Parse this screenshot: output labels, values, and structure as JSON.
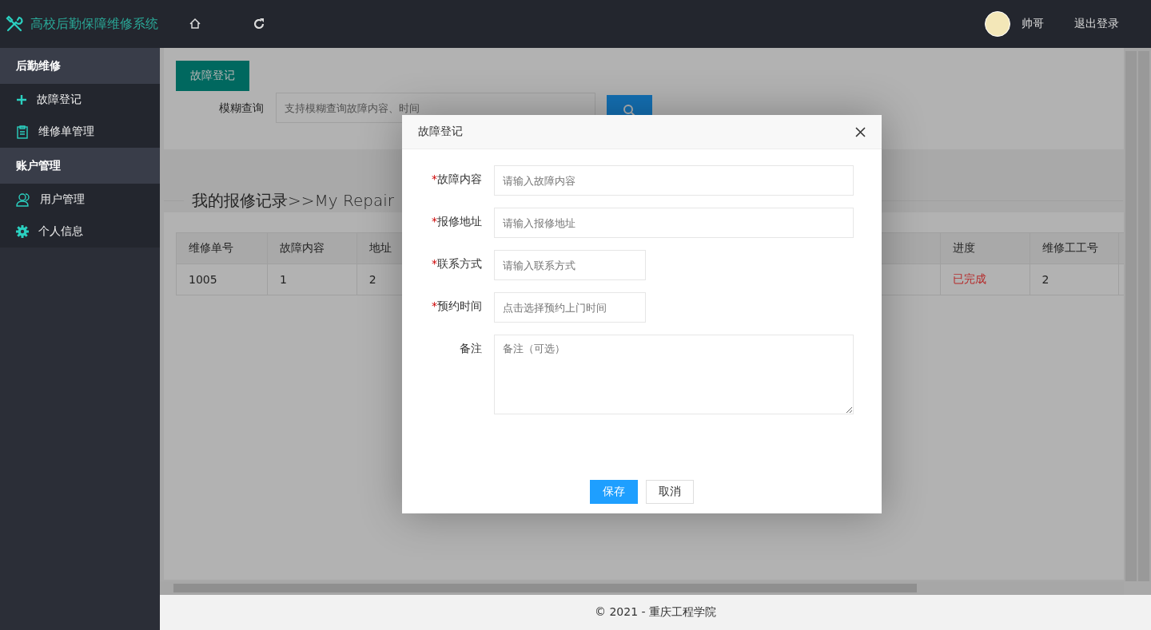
{
  "header": {
    "title": "高校后勤保障维修系统",
    "user": {
      "name": "帅哥"
    },
    "logout": "退出登录"
  },
  "sidebar": {
    "groups": [
      {
        "title": "后勤维修",
        "items": [
          {
            "label": "故障登记"
          },
          {
            "label": "维修单管理"
          }
        ]
      },
      {
        "title": "账户管理",
        "items": [
          {
            "label": "用户管理"
          },
          {
            "label": "个人信息"
          }
        ]
      }
    ]
  },
  "toolbar": {
    "add_button": "故障登记",
    "search_label": "模糊查询",
    "search": {
      "placeholder": "支持模糊查询故障内容、时间"
    }
  },
  "section_title": "我的报修记录>>My Repair",
  "table": {
    "columns": [
      "维修单号",
      "故障内容",
      "地址",
      "进度",
      "维修工工号"
    ],
    "rows": [
      {
        "cells": [
          "1005",
          "1",
          "2",
          {
            "text": "已完成",
            "color": "#b52a2a"
          },
          "2"
        ]
      }
    ]
  },
  "dialog": {
    "title": "故障登记",
    "required_mark": "*",
    "fields": [
      {
        "label": "故障内容",
        "required": true,
        "kind": "wide",
        "placeholder": "请输入故障内容"
      },
      {
        "label": "报修地址",
        "required": true,
        "kind": "wide",
        "placeholder": "请输入报修地址"
      },
      {
        "label": "联系方式",
        "required": true,
        "kind": "narrow",
        "placeholder": "请输入联系方式"
      },
      {
        "label": "预约时间",
        "required": true,
        "kind": "narrow",
        "placeholder": "点击选择预约上门时间"
      },
      {
        "label": "备注",
        "required": false,
        "kind": "textarea",
        "placeholder": "备注（可选）"
      }
    ],
    "buttons": [
      {
        "label": "保存",
        "kind": "primary"
      },
      {
        "label": "取消",
        "kind": "default"
      }
    ]
  },
  "footer": "© 2021 - 重庆工程学院"
}
